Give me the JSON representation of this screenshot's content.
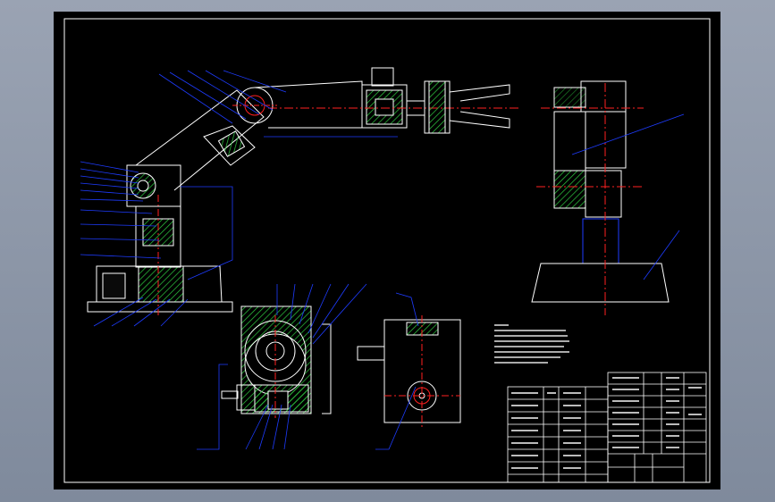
{
  "drawing": {
    "background_color": "#000000",
    "frame_color": "#ffffff",
    "leader_color": "#1e3cff",
    "hatch_color": "#2ecc40",
    "centerline_color": "#ff2020",
    "views": [
      "robot-arm-front-view",
      "side-view",
      "gear-section-view",
      "worm-box-view"
    ]
  },
  "notes": {
    "lines": []
  }
}
